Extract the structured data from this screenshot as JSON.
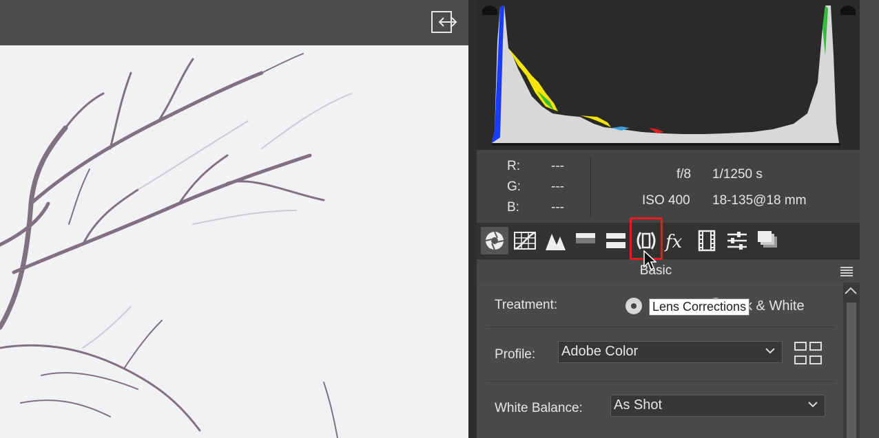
{
  "histogram_readout": {
    "r_label": "R:",
    "g_label": "G:",
    "b_label": "B:",
    "r_value": "---",
    "g_value": "---",
    "b_value": "---",
    "aperture": "f/8",
    "shutter": "1/1250 s",
    "iso": "ISO 400",
    "lens": "18-135@18 mm"
  },
  "toolbar": {
    "tools": [
      "basic",
      "tone-curve",
      "detail",
      "hsl",
      "split-toning",
      "lens-corrections",
      "effects",
      "camera-calibration",
      "presets",
      "snapshots"
    ]
  },
  "panel": {
    "section_title": "Basic",
    "treatment_label": "Treatment:",
    "treatment_option_partial": "k & White",
    "profile_label": "Profile:",
    "profile_value": "Adobe Color",
    "white_balance_label": "White Balance:",
    "white_balance_value": "As Shot"
  },
  "tooltip": {
    "text": "Lens Corrections"
  },
  "colors": {
    "highlight": "#e81c1c",
    "panel_bg": "#4a4a4a",
    "toolbar_bg": "#323232"
  }
}
